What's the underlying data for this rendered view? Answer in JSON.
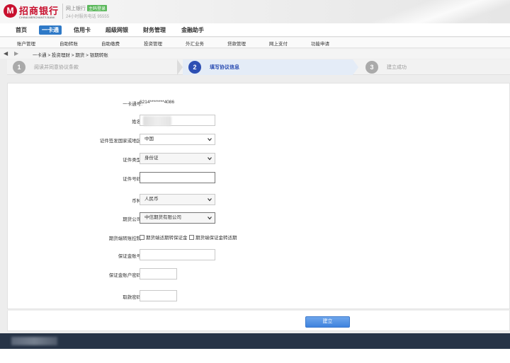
{
  "header": {
    "logo_letter": "M",
    "logo_cn": "招商银行",
    "logo_en": "CHINA MERCHANTS BANK",
    "netbank_label": "网上银行",
    "badge": "主码登录",
    "hotline": "24小时服务电话 95555"
  },
  "main_nav": [
    "首页",
    "一卡通",
    "信用卡",
    "超级网银",
    "财务管理",
    "金融助手"
  ],
  "main_nav_active": "一卡通",
  "sub_nav": [
    "账户管理",
    "自助转账",
    "自助缴费",
    "投资管理",
    "外汇业务",
    "贷款管理",
    "网上支付",
    "功能申请"
  ],
  "breadcrumb": {
    "back_icon": "triangle-left-icon",
    "forward_icon": "triangle-right-icon",
    "items": [
      "一卡通",
      "投资理财",
      "期货",
      "银期转账"
    ],
    "separator": ">"
  },
  "steps": [
    {
      "num": "1",
      "label": "阅读并同意协议条款",
      "active": false
    },
    {
      "num": "2",
      "label": "填写协议信息",
      "active": true
    },
    {
      "num": "3",
      "label": "建立成功",
      "active": false
    }
  ],
  "form": {
    "card_label": "一卡通号:",
    "card_value": "6214********4086",
    "name_label": "姓名:",
    "country_label": "证件签发国家或地区:",
    "country_value": "中国",
    "idtype_label": "证件类型:",
    "idtype_value": "身份证",
    "idno_label": "证件号码:",
    "currency_label": "币种:",
    "currency_value": "人民币",
    "company_label": "期货公司:",
    "company_value": "中信期货有限公司",
    "control_label": "期货端转账控制:",
    "control_opt1": "期货端适期转保证金",
    "control_opt2": "期货端保证金转适期",
    "margin_acct_label": "保证金账号:",
    "margin_pwd_label": "保证金账户密码:",
    "withdraw_pwd_label": "取款密码:",
    "submit_label": "建立"
  },
  "colors": {
    "brand_red": "#c8102e",
    "nav_active": "#2e79c7",
    "step_active": "#2d4fb3",
    "button": "#3e82de",
    "footer": "#273447"
  }
}
